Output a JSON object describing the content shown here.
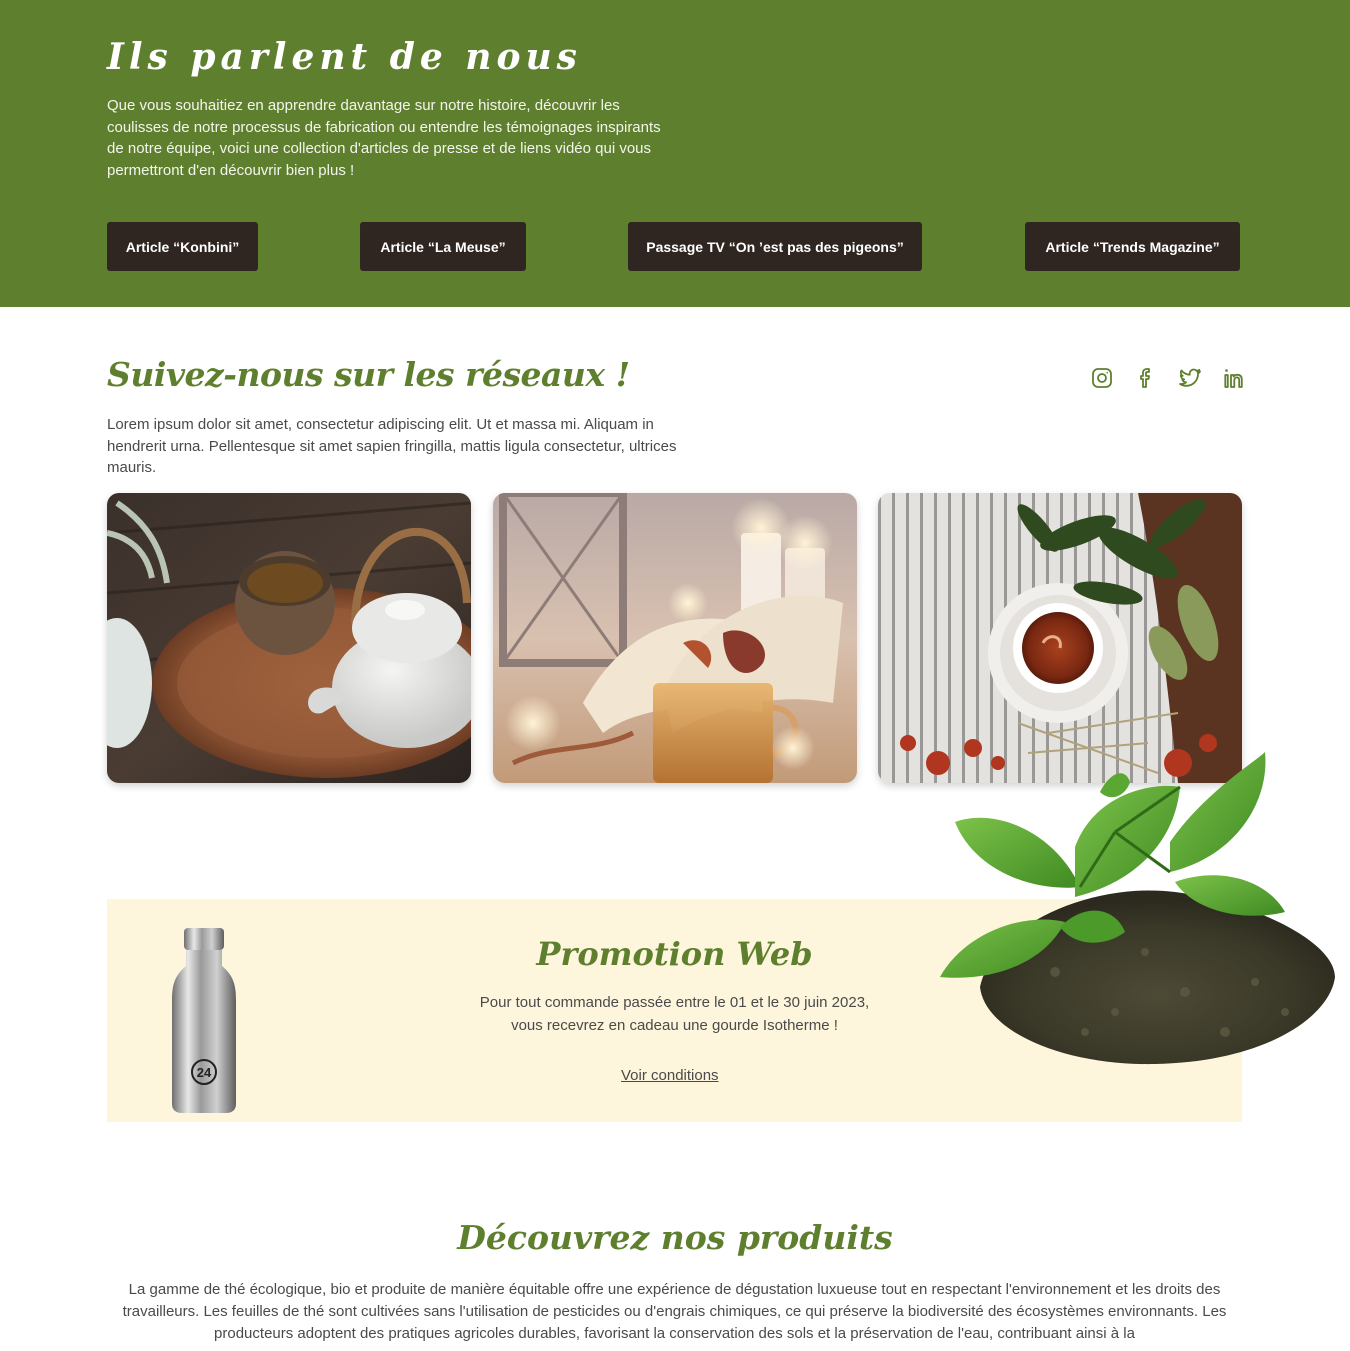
{
  "press": {
    "title": "Ils parlent de nous",
    "text": "Que vous souhaitiez en apprendre davantage sur notre histoire, découvrir les coulisses de notre processus de fabrication ou entendre les témoignages inspirants de notre équipe, voici une collection d'articles de presse et de liens vidéo qui vous permettront d'en découvrir bien plus !",
    "buttons": [
      "Article “Konbini”",
      "Article “La Meuse”",
      "Passage TV “On ’est pas des pigeons”",
      "Article “Trends Magazine”"
    ],
    "background_color": "#5e7f2e",
    "button_color": "#2f2622"
  },
  "social": {
    "title": "Suivez-nous sur les réseaux !",
    "text": "Lorem ipsum dolor sit amet, consectetur adipiscing elit. Ut et massa mi. Aliquam in hendrerit urna. Pellentesque sit amet sapien fringilla, mattis ligula consectetur, ultrices mauris.",
    "icons": [
      "instagram-icon",
      "facebook-icon",
      "twitter-icon",
      "linkedin-icon"
    ],
    "photos": [
      "teapot-and-cup-photo",
      "book-candles-tea-photo",
      "tea-cup-leaves-photo"
    ]
  },
  "promo": {
    "title": "Promotion Web",
    "text_line1": "Pour tout commande passée entre le 01 et le 30 juin 2023,",
    "text_line2": "vous recevrez en cadeau une gourde Isotherme !",
    "link": "Voir conditions",
    "background_color": "#fdf6dc",
    "bottle_label": "24"
  },
  "products": {
    "title": "Découvrez nos produits",
    "text": "La gamme de thé écologique, bio et produite de manière équitable offre une expérience de dégustation luxueuse tout en respectant l'environnement et les droits des travailleurs. Les feuilles de thé sont cultivées sans l'utilisation de pesticides ou d'engrais chimiques, ce qui préserve la biodiversité des écosystèmes environnants. Les producteurs adoptent des pratiques agricoles durables, favorisant la conservation des sols et la préservation de l'eau, contribuant ainsi à la"
  }
}
